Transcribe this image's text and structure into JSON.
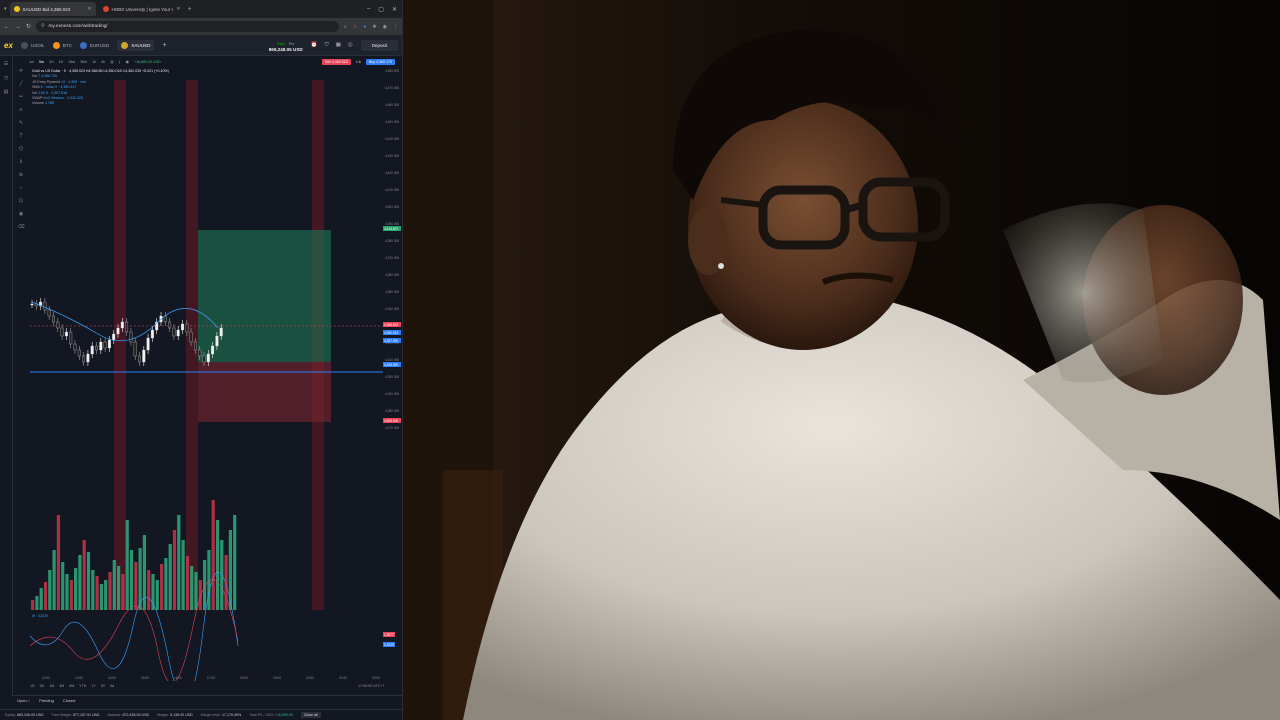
{
  "browser": {
    "tabs": [
      {
        "label": "XAUUSD Bid 4,360.023",
        "active": true,
        "favicon_color": "#f0c419"
      },
      {
        "label": "HOBX University | Ignite Your I",
        "active": false,
        "favicon_color": "#e0452b"
      }
    ],
    "url": "my.exness.com/webtrading/"
  },
  "app": {
    "logo": "ex",
    "instruments": [
      {
        "label": "USOIL",
        "color": "#4a4f5c"
      },
      {
        "label": "BTC",
        "color": "#f7931a"
      },
      {
        "label": "EURUSD",
        "color": "#3b6ec7"
      },
      {
        "label": "XAUUSD",
        "color": "#d4a72c",
        "active": true
      }
    ],
    "account_tag": "Real",
    "account_type": "Pro",
    "balance": "869,248.05 USD",
    "deposit_label": "Deposit"
  },
  "chart": {
    "timeframes": [
      "1m",
      "5m",
      "1H",
      "1D",
      "15m",
      "30m",
      "1h",
      "4h"
    ],
    "pl": "+16,800.00 USD",
    "sell_label": "Sell 4,360.023",
    "spread": "1.6",
    "buy_label": "Buy 4,360.179",
    "legend_title": "Gold vs US Dollar · 5 · 4,355.923 H4,366.85 L4,350.018 C4,362.035 +5.021 (+0.10%)",
    "legend_indicators": [
      {
        "name": "Vol 7",
        "value": "4,366.705"
      },
      {
        "name": "JH Entry Pyramid",
        "value": "14 · 4,355 · mtx"
      },
      {
        "name": "SMA",
        "value": "5 · close 0 · 4,360.447"
      },
      {
        "name": "Vol",
        "value": "1.60 5 · 4,357.816"
      },
      {
        "name": "VWAP",
        "value": "hlc3 Session · 4,341.320"
      },
      {
        "name": "Volume",
        "value": "1.78K"
      }
    ],
    "price_ticks": [
      "4,480.000",
      "4,470.000",
      "4,460.000",
      "4,450.000",
      "4,440.000",
      "4,430.000",
      "4,420.000",
      "4,410.000",
      "4,400.000",
      "4,390.000",
      "4,380.000",
      "4,370.000",
      "4,360.000",
      "4,350.000",
      "4,340.000",
      "4,330.000",
      "4,320.000",
      "4,310.000",
      "4,300.000",
      "4,290.000",
      "4,280.000",
      "4,270.000"
    ],
    "price_badges": [
      {
        "label": "4,416.607",
        "color": "#26a269"
      },
      {
        "label": "4,366.622",
        "color": "#e9435a"
      },
      {
        "label": "4,360.023",
        "color": "#2e7cf6"
      },
      {
        "label": "4,357.000",
        "color": "#2e7cf6"
      },
      {
        "label": "4,345.000",
        "color": "#2e7cf6"
      },
      {
        "label": "4,306.000",
        "color": "#e9435a"
      }
    ],
    "time_ticks": [
      "12:00",
      "13:00",
      "14:00",
      "15:00",
      "16:00",
      "17:00",
      "18:00",
      "19:00",
      "20:00",
      "21:00",
      "22:00"
    ],
    "oscillator_badges": [
      {
        "label": "1.3977",
        "color": "#e9435a"
      },
      {
        "label": "0.2229",
        "color": "#2e7cf6"
      }
    ],
    "oscillator_label": "W · 0.2229"
  },
  "bottom": {
    "tabs": [
      "Open",
      "Pending",
      "Closed"
    ],
    "open_count": "1",
    "periods": [
      "1D",
      "5D",
      "1M",
      "3M",
      "6M",
      "YTD",
      "1Y",
      "5Y",
      "All"
    ],
    "clock": "17:00:00 UTC+7",
    "status": [
      {
        "label": "Equity:",
        "value": "883,246.05 USD"
      },
      {
        "label": "Free Margin:",
        "value": "877,107.91 USD"
      },
      {
        "label": "Balance:",
        "value": "872,435.05 USD"
      },
      {
        "label": "Margin:",
        "value": "5,138.00 USD"
      },
      {
        "label": "Margin level:",
        "value": "17,176.49%"
      }
    ],
    "total_pl_label": "Total P/L, USD:",
    "total_pl": "+16,800.00",
    "close_all": "Close all"
  }
}
